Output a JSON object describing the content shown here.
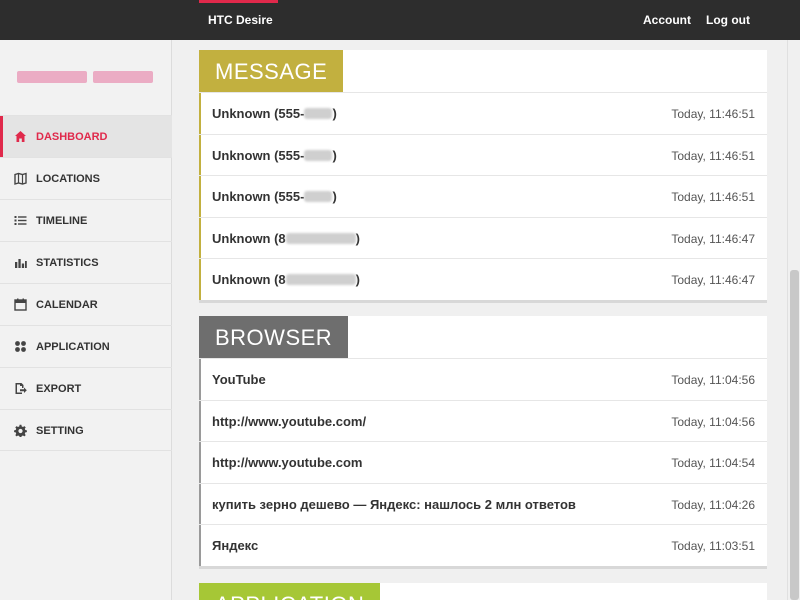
{
  "topbar": {
    "device": "HTC Desire",
    "account": "Account",
    "logout": "Log out"
  },
  "colors": {
    "accent": "#e0294b",
    "message": "#c2b03f",
    "browser": "#6e6e6e",
    "application": "#a6c736"
  },
  "sidebar": {
    "items": [
      {
        "label": "DASHBOARD",
        "icon": "home-icon"
      },
      {
        "label": "LOCATIONS",
        "icon": "map-icon"
      },
      {
        "label": "TIMELINE",
        "icon": "list-icon"
      },
      {
        "label": "STATISTICS",
        "icon": "bar-chart-icon"
      },
      {
        "label": "CALENDAR",
        "icon": "calendar-icon"
      },
      {
        "label": "APPLICATION",
        "icon": "apps-grid-icon"
      },
      {
        "label": "EXPORT",
        "icon": "export-icon"
      },
      {
        "label": "SETTING",
        "icon": "gear-icon"
      }
    ]
  },
  "message": {
    "title": "MESSAGE",
    "rows": [
      {
        "prefix": "Unknown (555-",
        "suffix": ")",
        "time": "Today, 11:46:51"
      },
      {
        "prefix": "Unknown (555-",
        "suffix": ")",
        "time": "Today, 11:46:51"
      },
      {
        "prefix": "Unknown (555-",
        "suffix": ")",
        "time": "Today, 11:46:51"
      },
      {
        "prefix": "Unknown (8",
        "suffix": ")",
        "time": "Today, 11:46:47"
      },
      {
        "prefix": "Unknown (8",
        "suffix": ")",
        "time": "Today, 11:46:47"
      }
    ]
  },
  "browser": {
    "title": "BROWSER",
    "rows": [
      {
        "text": "YouTube",
        "time": "Today, 11:04:56"
      },
      {
        "text": "http://www.youtube.com/",
        "time": "Today, 11:04:56"
      },
      {
        "text": "http://www.youtube.com",
        "time": "Today, 11:04:54"
      },
      {
        "text": "купить зерно дешево — Яндекс: нашлось 2 млн ответов",
        "time": "Today, 11:04:26"
      },
      {
        "text": "Яндекс",
        "time": "Today, 11:03:51"
      }
    ]
  },
  "application": {
    "title": "APPLICATION"
  }
}
